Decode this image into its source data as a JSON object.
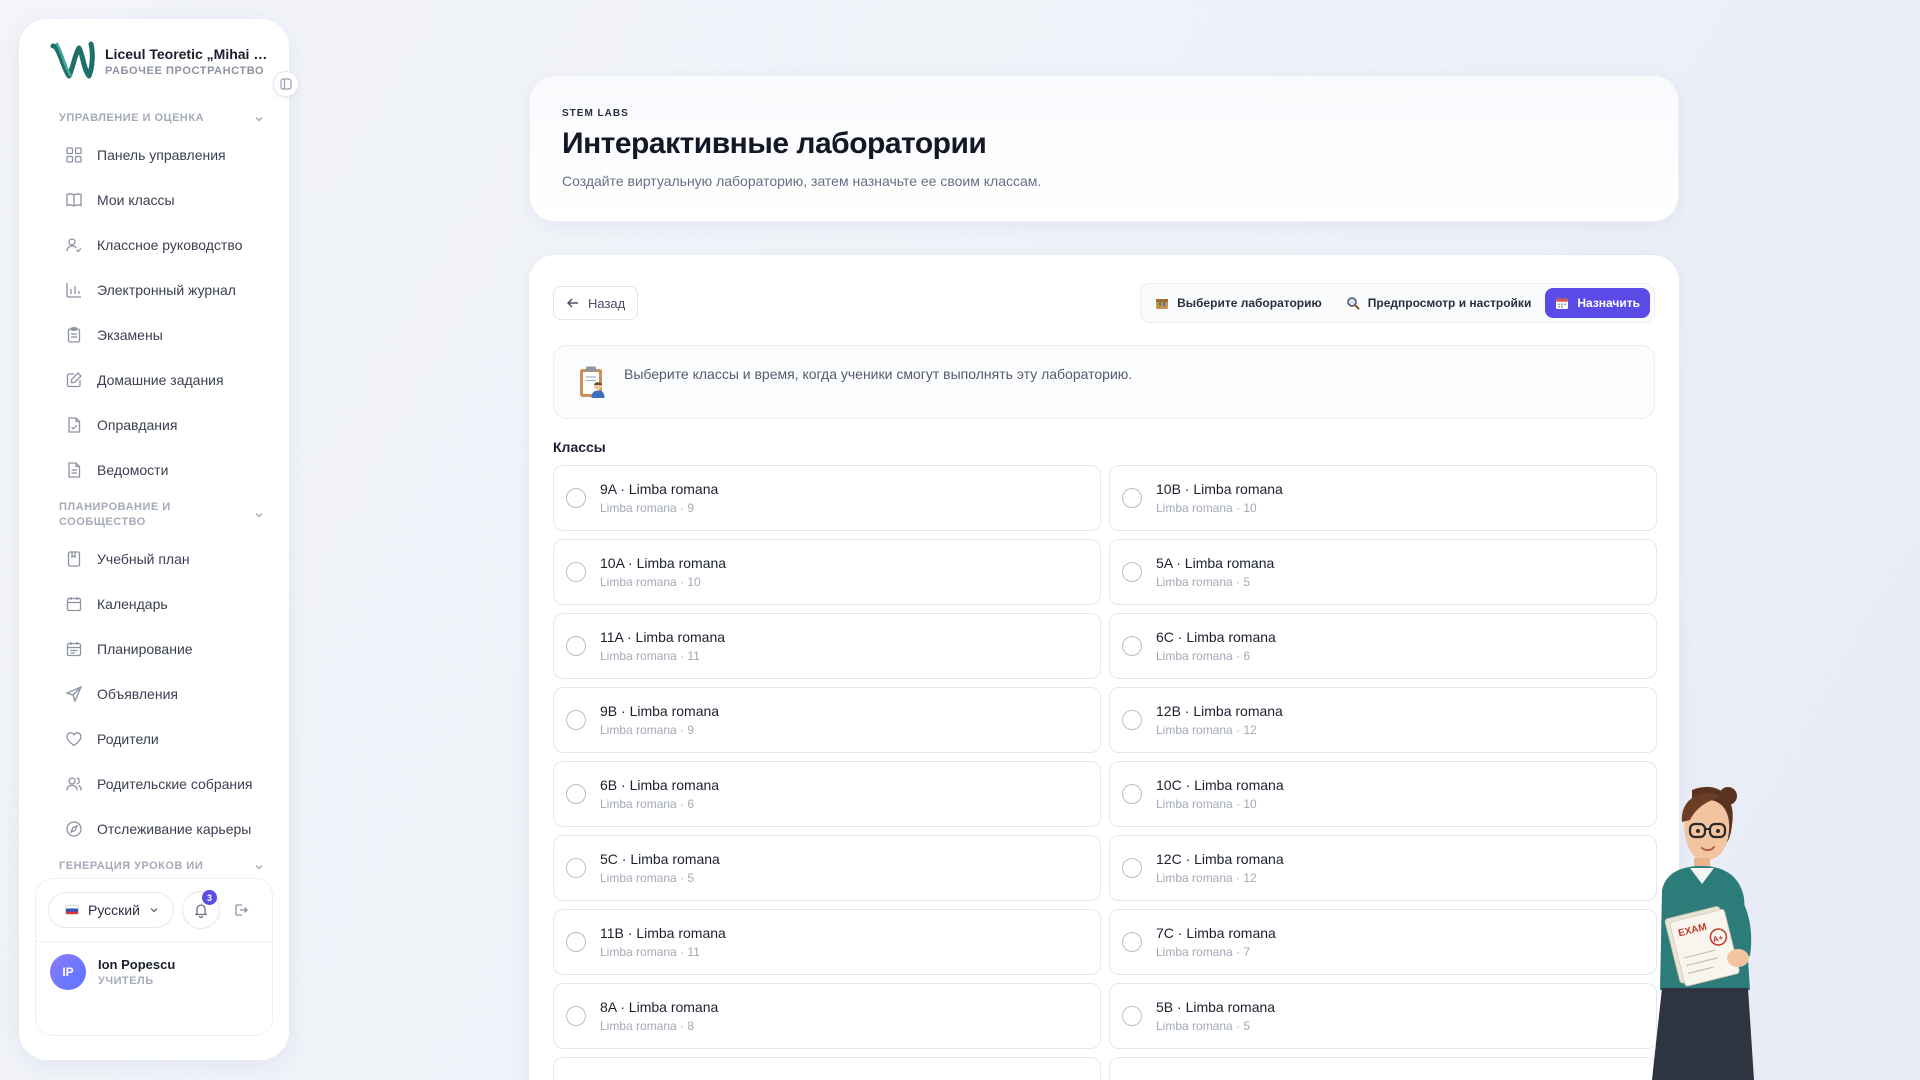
{
  "sidebar": {
    "brand_name": "Liceul Teoretic „Mihai Eminescu”",
    "brand_sub": "РАБОЧЕЕ ПРОСТРАНСТВО",
    "sections": [
      {
        "title": "УПРАВЛЕНИЕ И ОЦЕНКА",
        "items": [
          {
            "label": "Панель управления",
            "icon": "dashboard-icon"
          },
          {
            "label": "Мои классы",
            "icon": "book-icon"
          },
          {
            "label": "Классное руководство",
            "icon": "user-check-icon"
          },
          {
            "label": "Электронный журнал",
            "icon": "bar-chart-icon"
          },
          {
            "label": "Экзамены",
            "icon": "clipboard-icon"
          },
          {
            "label": "Домашние задания",
            "icon": "edit-note-icon"
          },
          {
            "label": "Оправдания",
            "icon": "file-check-icon"
          },
          {
            "label": "Ведомости",
            "icon": "file-text-icon"
          }
        ]
      },
      {
        "title": "ПЛАНИРОВАНИЕ И СООБЩЕСТВО",
        "items": [
          {
            "label": "Учебный план",
            "icon": "notebook-icon"
          },
          {
            "label": "Календарь",
            "icon": "calendar-icon"
          },
          {
            "label": "Планирование",
            "icon": "calendar-list-icon"
          },
          {
            "label": "Объявления",
            "icon": "send-icon"
          },
          {
            "label": "Родители",
            "icon": "heart-icon"
          },
          {
            "label": "Родительские собрания",
            "icon": "users-icon"
          },
          {
            "label": "Отслеживание карьеры",
            "icon": "compass-icon"
          }
        ]
      },
      {
        "title": "ГЕНЕРАЦИЯ УРОКОВ ИИ",
        "items": []
      }
    ],
    "footer": {
      "language": "Русский",
      "notifications": "3",
      "user_initials": "IP",
      "user_name": "Ion Popescu",
      "user_role": "УЧИТЕЛЬ"
    }
  },
  "header": {
    "eyebrow": "STEM LABS",
    "title": "Интерактивные лаборатории",
    "subtitle": "Создайте виртуальную лабораторию, затем назначьте ее своим классам."
  },
  "main": {
    "back_label": "Назад",
    "steps": [
      {
        "label": "Выберите лабораторию",
        "active": false
      },
      {
        "label": "Предпросмотр и настройки",
        "active": false
      },
      {
        "label": "Назначить",
        "active": true
      }
    ],
    "info_text": "Выберите классы и время, когда ученики смогут выполнять эту лабораторию.",
    "classes_label": "Классы",
    "classes": [
      {
        "title": "9A · Limba romana",
        "sub": "Limba romana · 9"
      },
      {
        "title": "10B · Limba romana",
        "sub": "Limba romana · 10"
      },
      {
        "title": "10A · Limba romana",
        "sub": "Limba romana · 10"
      },
      {
        "title": "5A · Limba romana",
        "sub": "Limba romana · 5"
      },
      {
        "title": "11A · Limba romana",
        "sub": "Limba romana · 11"
      },
      {
        "title": "6C · Limba romana",
        "sub": "Limba romana · 6"
      },
      {
        "title": "9B · Limba romana",
        "sub": "Limba romana · 9"
      },
      {
        "title": "12B · Limba romana",
        "sub": "Limba romana · 12"
      },
      {
        "title": "6B · Limba romana",
        "sub": "Limba romana · 6"
      },
      {
        "title": "10C · Limba romana",
        "sub": "Limba romana · 10"
      },
      {
        "title": "5C · Limba romana",
        "sub": "Limba romana · 5"
      },
      {
        "title": "12C · Limba romana",
        "sub": "Limba romana · 12"
      },
      {
        "title": "11B · Limba romana",
        "sub": "Limba romana · 11"
      },
      {
        "title": "7C · Limba romana",
        "sub": "Limba romana · 7"
      },
      {
        "title": "8A · Limba romana",
        "sub": "Limba romana · 8"
      },
      {
        "title": "5B · Limba romana",
        "sub": "Limba romana · 5"
      },
      {
        "title": "",
        "sub": ""
      },
      {
        "title": "",
        "sub": ""
      }
    ]
  },
  "mascot": {
    "exam_text": "EXAM",
    "grade_text": "A+"
  },
  "colors": {
    "accent": "#5b4be6",
    "brand_teal": "#1f6f6a"
  }
}
